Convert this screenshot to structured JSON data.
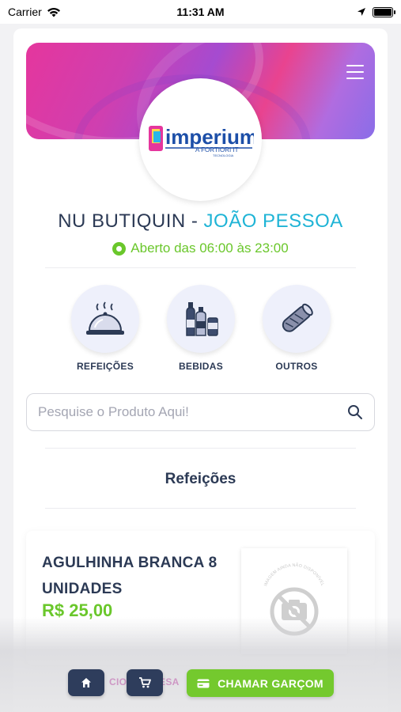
{
  "status_bar": {
    "carrier": "Carrier",
    "time": "11:31 AM"
  },
  "store": {
    "name": "NU BUTIQUIN",
    "separator": " - ",
    "city": "JOÃO PESSOA",
    "hours": "Aberto das 06:00 às 23:00",
    "logo": {
      "brand": "imperium",
      "tagline": "A FORTIORI IT",
      "sub": "TECNOLOGIA"
    }
  },
  "categories": [
    {
      "label": "REFEIÇÕES",
      "icon": "cloche-icon"
    },
    {
      "label": "BEBIDAS",
      "icon": "bottles-icon"
    },
    {
      "label": "OUTROS",
      "icon": "burrito-icon"
    }
  ],
  "search": {
    "placeholder": "Pesquise o Produto Aqui!",
    "value": ""
  },
  "section": {
    "title": "Refeições"
  },
  "products": [
    {
      "name": "AGULHINHA BRANCA 8 UNIDADES",
      "price": "R$ 25,00",
      "image_placeholder": "IMAGEM AINDA NÃO DISPONÍVEL"
    }
  ],
  "bottom_bar": {
    "ghost_text": "CIONAR MESA",
    "home_icon": "home-icon",
    "cart_icon": "cart-icon",
    "call_waiter_label": "CHAMAR GARÇOM"
  },
  "colors": {
    "primary": "#2c3a55",
    "accent_cyan": "#1fb4d6",
    "green": "#6ac72b",
    "button_dark": "#2e3d5c",
    "button_green": "#74c92e"
  }
}
